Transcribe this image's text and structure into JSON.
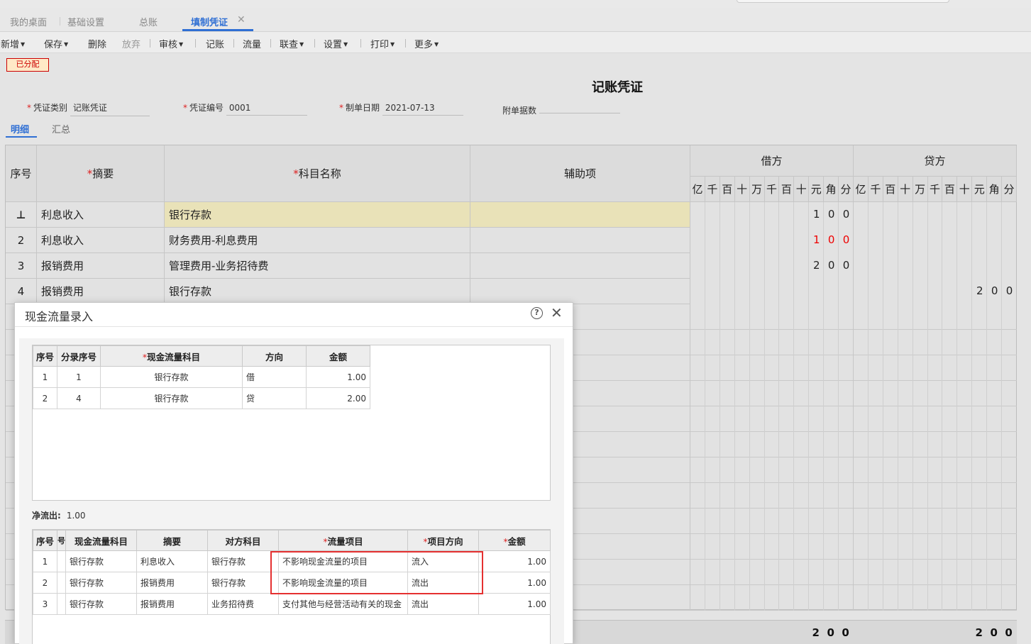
{
  "tabs": [
    {
      "label": "我的桌面"
    },
    {
      "label": "基础设置"
    },
    {
      "label": "总账"
    },
    {
      "label": "填制凭证"
    }
  ],
  "toolbar": [
    {
      "label": "新增",
      "caret": true
    },
    {
      "label": "保存",
      "caret": true
    },
    {
      "label": "删除",
      "caret": false
    },
    {
      "label": "放弃",
      "caret": false
    },
    {
      "label": "审核",
      "caret": true
    },
    {
      "label": "记账",
      "caret": false
    },
    {
      "label": "流量",
      "caret": false
    },
    {
      "label": "联查",
      "caret": true
    },
    {
      "label": "设置",
      "caret": true
    },
    {
      "label": "打印",
      "caret": true
    },
    {
      "label": "更多",
      "caret": true
    }
  ],
  "badge": "已分配",
  "voucher": {
    "title": "记账凭证",
    "type_label": "凭证类别",
    "type_value": "记账凭证",
    "no_label": "凭证编号",
    "no_value": "0001",
    "date_label": "制单日期",
    "date_value": "2021-07-13",
    "attach_label": "附单据数",
    "attach_value": ""
  },
  "subtabs": [
    "明细",
    "汇总"
  ],
  "grid": {
    "headers": {
      "seq": "序号",
      "summary": "摘要",
      "account": "科目名称",
      "aux": "辅助项",
      "debit": "借方",
      "credit": "贷方"
    },
    "units": [
      "亿",
      "千",
      "百",
      "十",
      "万",
      "千",
      "百",
      "十",
      "元",
      "角",
      "分"
    ],
    "rows": [
      {
        "seq": "",
        "summary": "利息收入",
        "account": "银行存款",
        "aux": "",
        "debit": [
          "1",
          "0",
          "0"
        ],
        "credit": [],
        "red": false
      },
      {
        "seq": "2",
        "summary": "利息收入",
        "account": "财务费用-利息费用",
        "aux": "",
        "debit": [
          "1",
          "0",
          "0"
        ],
        "credit": [],
        "red": true
      },
      {
        "seq": "3",
        "summary": "报销费用",
        "account": "管理费用-业务招待费",
        "aux": "",
        "debit": [
          "2",
          "0",
          "0"
        ],
        "credit": [],
        "red": false
      },
      {
        "seq": "4",
        "summary": "报销费用",
        "account": "银行存款",
        "aux": "",
        "debit": [],
        "credit": [
          "2",
          "0",
          "0"
        ],
        "red": false
      }
    ],
    "totals": {
      "debit": [
        "2",
        "0",
        "0"
      ],
      "credit": [
        "2",
        "0",
        "0"
      ]
    }
  },
  "dialog": {
    "title": "现金流量录入",
    "table1": {
      "headers": [
        "序号",
        "分录序号",
        "现金流量科目",
        "方向",
        "金额"
      ],
      "rows": [
        [
          "1",
          "1",
          "银行存款",
          "借",
          "1.00"
        ],
        [
          "2",
          "4",
          "银行存款",
          "贷",
          "2.00"
        ]
      ]
    },
    "net_label": "净流出:",
    "net_value": "1.00",
    "table2": {
      "headers": [
        "序号",
        "",
        "现金流量科目",
        "摘要",
        "对方科目",
        "流量项目",
        "项目方向",
        "金额"
      ],
      "rows": [
        [
          "1",
          "",
          "银行存款",
          "利息收入",
          "银行存款",
          "不影响现金流量的项目",
          "流入",
          "1.00"
        ],
        [
          "2",
          "",
          "银行存款",
          "报销费用",
          "银行存款",
          "不影响现金流量的项目",
          "流出",
          "1.00"
        ],
        [
          "3",
          "",
          "银行存款",
          "报销费用",
          "业务招待费",
          "支付其他与经营活动有关的现金",
          "流出",
          "1.00"
        ]
      ]
    }
  }
}
